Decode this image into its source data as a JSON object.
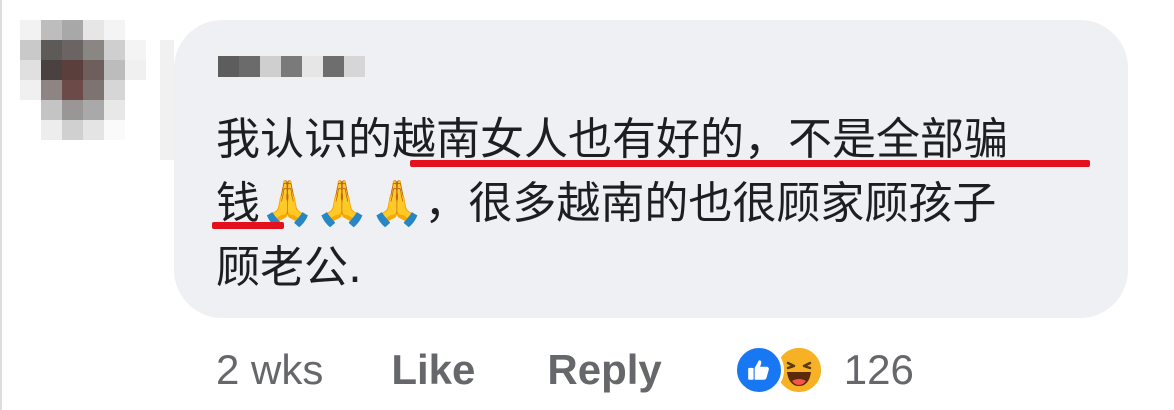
{
  "comment": {
    "text_lines": [
      "我认识的越南女人也有好的，不是全部骗",
      "钱🙏🙏🙏，很多越南的也很顾家顾孩子",
      "顾老公."
    ]
  },
  "actions": {
    "timestamp": "2 wks",
    "like_label": "Like",
    "reply_label": "Reply",
    "reaction_count": "126",
    "reaction_icons": [
      "thumbs-up-icon",
      "laughing-face-icon"
    ]
  },
  "colors": {
    "bubble": "#eff0f3",
    "text": "#1c1e21",
    "meta": "#65676b",
    "underline": "#e4101e",
    "like": "#1877f2",
    "haha": "#f7b125"
  }
}
